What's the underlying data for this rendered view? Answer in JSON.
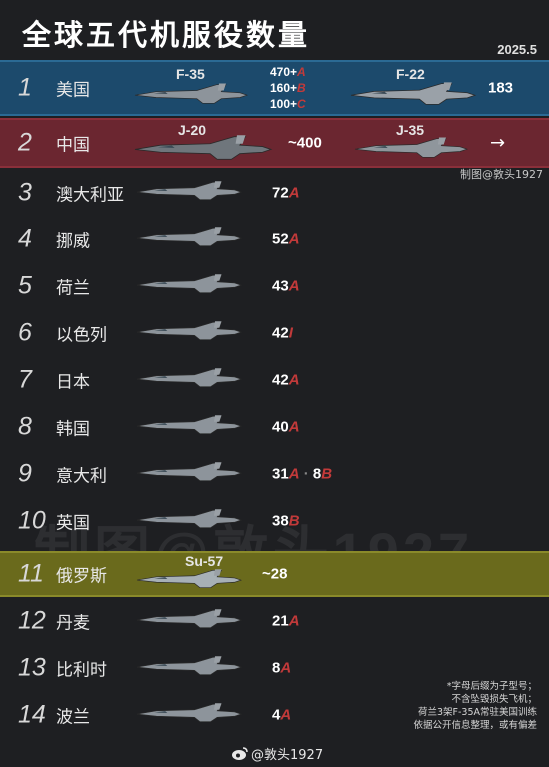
{
  "title": "全球五代机服役数量",
  "date": "2025.5",
  "credit": "制图@敦头1927",
  "watermark": "制图@敦头1927",
  "footer": "@敦头1927",
  "note": [
    "*字母后缀为子型号；",
    "不含坠毁损失飞机；",
    "荷兰3架F-35A常驻美国训练",
    "依据公开信息整理，或有偏差"
  ],
  "colors": {
    "background": "#1e1f22",
    "us_band": "#1c4a6c",
    "china_band": "#6b2630",
    "russia_band": "#6a6a1c",
    "variant_letter": "#c23a3a"
  },
  "chart_data": {
    "type": "table",
    "title": "全球五代机服役数量",
    "date": "2025.5",
    "rows": [
      {
        "rank": "1",
        "country": "美国",
        "aircraft": [
          {
            "model": "F-35",
            "counts": [
              {
                "value": "470+",
                "variant": "A"
              },
              {
                "value": "160+",
                "variant": "B"
              },
              {
                "value": "100+",
                "variant": "C"
              }
            ]
          },
          {
            "model": "F-22",
            "counts": [
              {
                "value": "183",
                "variant": ""
              }
            ]
          }
        ]
      },
      {
        "rank": "2",
        "country": "中国",
        "aircraft": [
          {
            "model": "J-20",
            "counts": [
              {
                "value": "~400",
                "variant": ""
              }
            ]
          },
          {
            "model": "J-35",
            "counts": [
              {
                "value": "→",
                "variant": ""
              }
            ]
          }
        ]
      },
      {
        "rank": "3",
        "country": "澳大利亚",
        "aircraft": [
          {
            "model": "F-35",
            "counts": [
              {
                "value": "72",
                "variant": "A"
              }
            ]
          }
        ]
      },
      {
        "rank": "4",
        "country": "挪威",
        "aircraft": [
          {
            "model": "F-35",
            "counts": [
              {
                "value": "52",
                "variant": "A"
              }
            ]
          }
        ]
      },
      {
        "rank": "5",
        "country": "荷兰",
        "aircraft": [
          {
            "model": "F-35",
            "counts": [
              {
                "value": "43",
                "variant": "A"
              }
            ]
          }
        ]
      },
      {
        "rank": "6",
        "country": "以色列",
        "aircraft": [
          {
            "model": "F-35",
            "counts": [
              {
                "value": "42",
                "variant": "I"
              }
            ]
          }
        ]
      },
      {
        "rank": "7",
        "country": "日本",
        "aircraft": [
          {
            "model": "F-35",
            "counts": [
              {
                "value": "42",
                "variant": "A"
              }
            ]
          }
        ]
      },
      {
        "rank": "8",
        "country": "韩国",
        "aircraft": [
          {
            "model": "F-35",
            "counts": [
              {
                "value": "40",
                "variant": "A"
              }
            ]
          }
        ]
      },
      {
        "rank": "9",
        "country": "意大利",
        "aircraft": [
          {
            "model": "F-35",
            "counts": [
              {
                "value": "31",
                "variant": "A"
              },
              {
                "value": "8",
                "variant": "B"
              }
            ]
          }
        ]
      },
      {
        "rank": "10",
        "country": "英国",
        "aircraft": [
          {
            "model": "F-35",
            "counts": [
              {
                "value": "38",
                "variant": "B"
              }
            ]
          }
        ]
      },
      {
        "rank": "11",
        "country": "俄罗斯",
        "aircraft": [
          {
            "model": "Su-57",
            "counts": [
              {
                "value": "~28",
                "variant": ""
              }
            ]
          }
        ]
      },
      {
        "rank": "12",
        "country": "丹麦",
        "aircraft": [
          {
            "model": "F-35",
            "counts": [
              {
                "value": "21",
                "variant": "A"
              }
            ]
          }
        ]
      },
      {
        "rank": "13",
        "country": "比利时",
        "aircraft": [
          {
            "model": "F-35",
            "counts": [
              {
                "value": "8",
                "variant": "A"
              }
            ]
          }
        ]
      },
      {
        "rank": "14",
        "country": "波兰",
        "aircraft": [
          {
            "model": "F-35",
            "counts": [
              {
                "value": "4",
                "variant": "A"
              }
            ]
          }
        ]
      }
    ]
  }
}
